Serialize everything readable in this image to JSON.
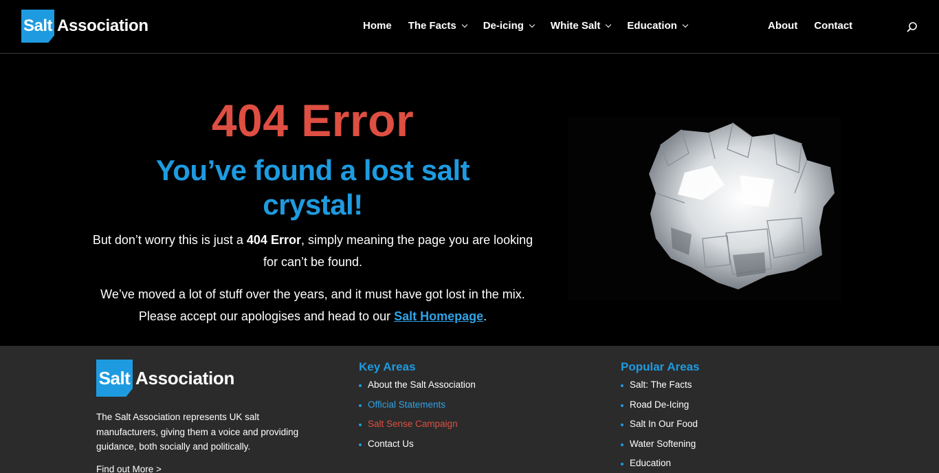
{
  "brand": {
    "logo_box": "Salt",
    "logo_word": "Association"
  },
  "nav": {
    "items": [
      {
        "label": "Home",
        "dropdown": false
      },
      {
        "label": "The Facts",
        "dropdown": true
      },
      {
        "label": "De-icing",
        "dropdown": true
      },
      {
        "label": "White Salt",
        "dropdown": true
      },
      {
        "label": "Education",
        "dropdown": true
      }
    ],
    "right": [
      {
        "label": "About"
      },
      {
        "label": "Contact"
      }
    ],
    "search_icon": "search-icon"
  },
  "hero": {
    "title": "404 Error",
    "subtitle": "You’ve found a lost salt crystal!",
    "p1_before": "But don’t worry this is just a ",
    "p1_bold": "404 Error",
    "p1_after": ", simply meaning the page you are looking for can’t be found.",
    "p2_before": "We’ve moved a lot of stuff over the years, and it must have got lost in the mix. Please accept our apologises and head to our ",
    "p2_link": "Salt Homepage",
    "p2_after": "."
  },
  "footer": {
    "description": "The Salt Association represents UK salt manufacturers, giving them a voice and providing guidance, both socially and politically.",
    "find_more": "Find out More >",
    "key_areas": {
      "title": "Key Areas",
      "items": [
        {
          "label": "About the Salt Association",
          "color": "#ffffff"
        },
        {
          "label": "Official Statements",
          "color": "#2fa3e6"
        },
        {
          "label": "Salt Sense Campaign",
          "color": "#dd4f42"
        },
        {
          "label": "Contact Us",
          "color": "#ffffff"
        }
      ]
    },
    "popular_areas": {
      "title": "Popular Areas",
      "items": [
        {
          "label": "Salt: The Facts"
        },
        {
          "label": "Road De-Icing"
        },
        {
          "label": "Salt In Our Food"
        },
        {
          "label": "Water Softening"
        },
        {
          "label": "Education"
        }
      ]
    }
  },
  "colors": {
    "accent_blue": "#1e9be0",
    "error_red": "#dd4f42",
    "footer_bg": "#2b2b2b"
  }
}
